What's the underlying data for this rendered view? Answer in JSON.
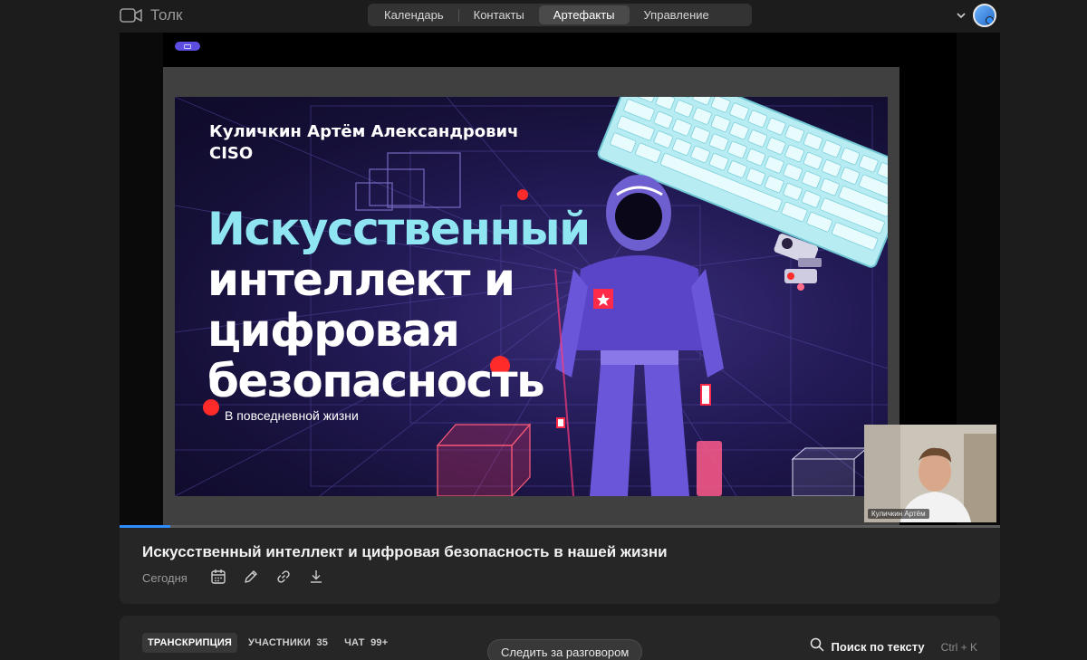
{
  "app": {
    "name": "Толк"
  },
  "nav": {
    "tabs": [
      {
        "label": "Календарь"
      },
      {
        "label": "Контакты"
      },
      {
        "label": "Артефакты"
      },
      {
        "label": "Управление"
      }
    ]
  },
  "slide": {
    "author": "Куличкин Артём Александрович",
    "role": "CISO",
    "title_line1": "Искусственный",
    "title_line2": "интеллект и",
    "title_line3": "цифровая",
    "title_line4": "безопасность",
    "subtitle": "В повседневной жизни"
  },
  "pip": {
    "name": "Куличкин Артём"
  },
  "progress": {
    "percent": 5.8
  },
  "info": {
    "title": "Искусственный интеллект и цифровая безопасность в нашей жизни",
    "date": "Сегодня"
  },
  "tabs": {
    "transcription": "ТРАНСКРИПЦИЯ",
    "participants": "УЧАСТНИКИ",
    "participants_count": "35",
    "chat": "ЧАТ",
    "chat_count": "99+"
  },
  "follow": {
    "label": "Следить за разговором"
  },
  "search": {
    "label": "Поиск по тексту",
    "shortcut": "Ctrl + K"
  },
  "colors": {
    "accent": "#2f8cff",
    "title_cyan": "#8fe6f2",
    "badge": "#5b4ee0"
  }
}
